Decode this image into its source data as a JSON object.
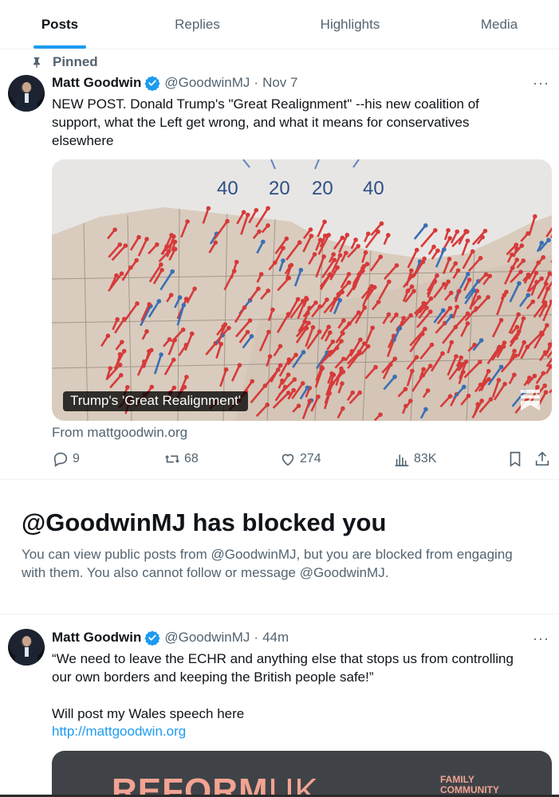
{
  "tabs": [
    {
      "label": "Posts",
      "active": true
    },
    {
      "label": "Replies",
      "active": false
    },
    {
      "label": "Highlights",
      "active": false
    },
    {
      "label": "Media",
      "active": false
    }
  ],
  "pinned_label": "Pinned",
  "pinned_tweet": {
    "name": "Matt Goodwin",
    "handle": "@GoodwinMJ",
    "separator": "·",
    "time": "Nov 7",
    "more": "···",
    "text": "NEW POST. Donald Trump's \"Great Realignment\" --his new coalition of support, what the Left get wrong, and what it means for conservatives elsewhere",
    "card": {
      "title": "Trump's 'Great Realignment'",
      "map_labels": [
        "40",
        "20",
        "20",
        "40"
      ],
      "source": "From mattgoodwin.org"
    },
    "stats": {
      "replies": "9",
      "reposts": "68",
      "likes": "274",
      "views": "83K"
    }
  },
  "blocked": {
    "title": "@GoodwinMJ has blocked you",
    "text": "You can view public posts from @GoodwinMJ, but you are blocked from engaging with them. You also cannot follow or message @GoodwinMJ."
  },
  "second_tweet": {
    "name": "Matt Goodwin",
    "handle": "@GoodwinMJ",
    "separator": "·",
    "time": "44m",
    "more": "···",
    "text": "“We need to leave the ECHR and anything else that stops us from controlling our own borders and keeping the British people safe!”\n\nWill post my Wales speech here",
    "link": "http://mattgoodwin.org",
    "media": {
      "banner_text": "REFORM",
      "banner_suffix": "UK",
      "side_text_1": "FAMILY",
      "side_text_2": "COMMUNITY"
    }
  },
  "colors": {
    "accent": "#1d9bf0",
    "text": "#0f1419",
    "muted": "#536471",
    "border": "#eff3f4",
    "arrow_red": "#d63a3a",
    "arrow_blue": "#3a6fb5"
  },
  "icons": [
    "pin-icon",
    "verified-badge-icon",
    "more-icon",
    "reply-icon",
    "repost-icon",
    "like-icon",
    "views-icon",
    "bookmark-icon",
    "share-icon"
  ]
}
